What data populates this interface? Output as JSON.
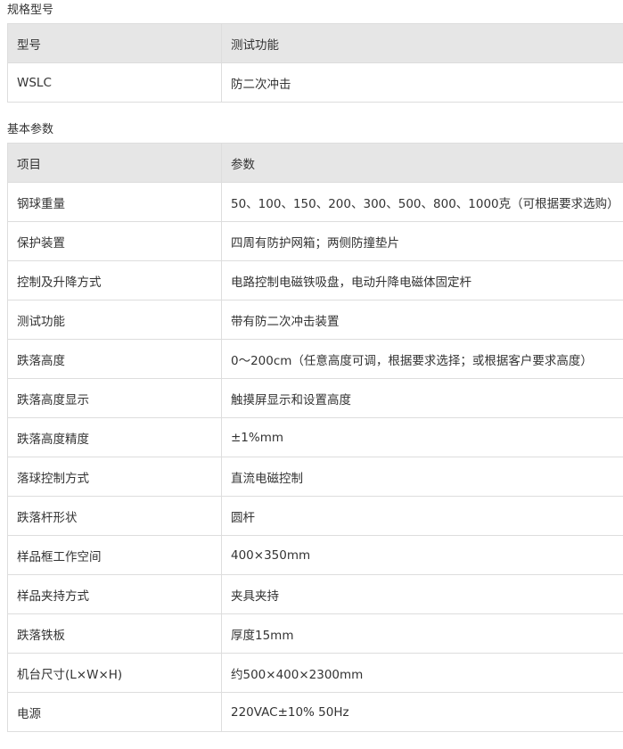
{
  "model_section": {
    "title": "规格型号",
    "headers": [
      "型号",
      "测试功能"
    ],
    "rows": [
      [
        "WSLC",
        "防二次冲击"
      ]
    ]
  },
  "params_section": {
    "title": "基本参数",
    "headers": [
      "项目",
      "参数"
    ],
    "rows": [
      [
        "钢球重量",
        "50、100、150、200、300、500、800、1000克（可根据要求选购）"
      ],
      [
        "保护装置",
        "四周有防护网箱；两侧防撞垫片"
      ],
      [
        "控制及升降方式",
        "电路控制电磁铁吸盘，电动升降电磁体固定杆"
      ],
      [
        "测试功能",
        "带有防二次冲击装置"
      ],
      [
        "跌落高度",
        "0～200cm（任意高度可调，根据要求选择；或根据客户要求高度）"
      ],
      [
        "跌落高度显示",
        "触摸屏显示和设置高度"
      ],
      [
        "跌落高度精度",
        "±1%mm"
      ],
      [
        "落球控制方式",
        "直流电磁控制"
      ],
      [
        "跌落杆形状",
        "圆杆"
      ],
      [
        "样品框工作空间",
        "400×350mm"
      ],
      [
        "样品夹持方式",
        "夹具夹持"
      ],
      [
        "跌落铁板",
        "厚度15mm"
      ],
      [
        "机台尺寸(L×W×H)",
        "约500×400×2300mm"
      ],
      [
        "电源",
        "220VAC±10% 50Hz"
      ]
    ]
  }
}
